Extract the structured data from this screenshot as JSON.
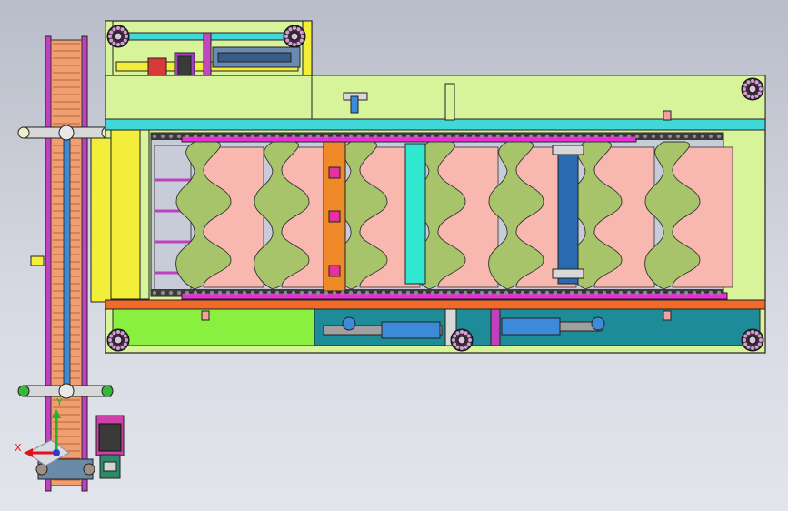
{
  "viewport": {
    "background_top": "#b9bdc9",
    "background_bottom": "#e3e5ec"
  },
  "axis_triad": {
    "x_label": "X",
    "y_label": "Y",
    "x_color": "#e0141e",
    "y_color": "#22b422",
    "z_color": "#2a3cd6"
  },
  "colors": {
    "frame_lime": "#d8f49a",
    "frame_yellow": "#f2ee3a",
    "rail_cyan": "#40d8d8",
    "rail_orange": "#f06a2a",
    "rail_magenta": "#e830d8",
    "pad_pink": "#f8b8b0",
    "plate_olive": "#a8c46a",
    "tray_green": "#8af040",
    "tray_teal": "#1e8c98",
    "cylinder_blue": "#2a6ab0",
    "bracket_orange": "#f08a28",
    "bracket_cyan": "#30e8d0",
    "chain_dark": "#3a3a3a",
    "belt_salmon": "#f0a070",
    "motor_magenta": "#d040a8"
  },
  "components": {
    "shells": 7,
    "sprockets": 6
  }
}
